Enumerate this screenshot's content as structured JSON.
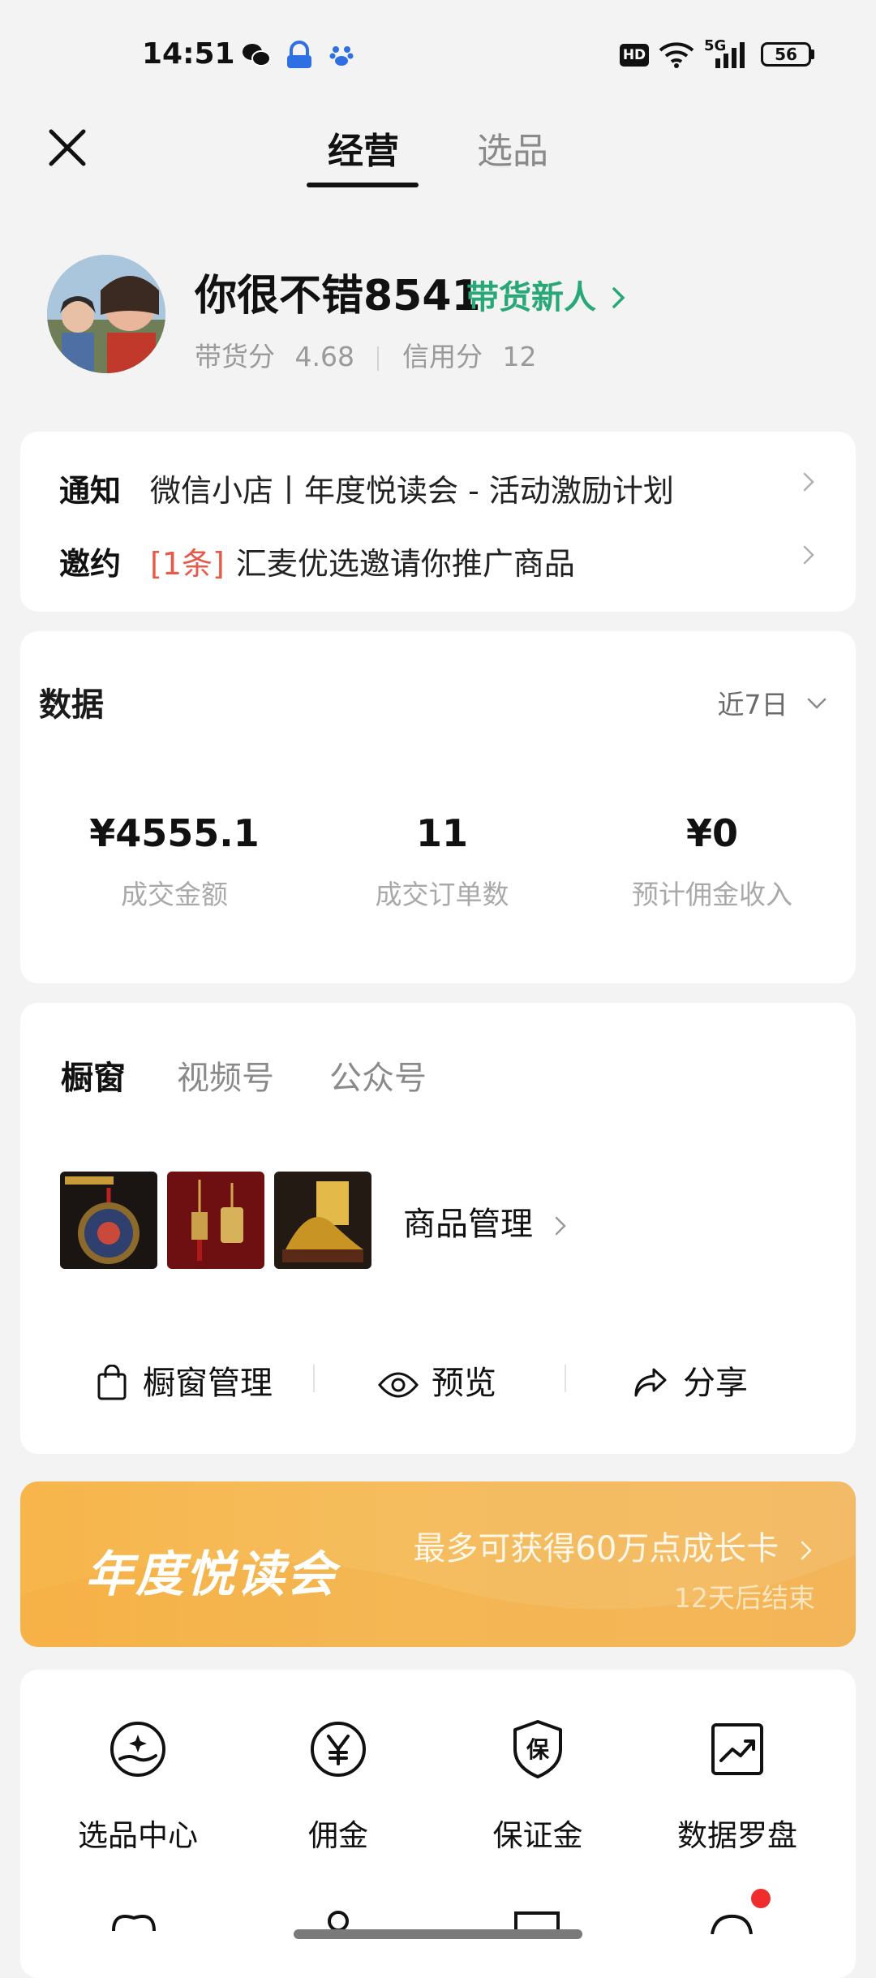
{
  "status_bar": {
    "time": "14:51",
    "network_label": "5G",
    "battery": "56",
    "hd_label": "HD"
  },
  "nav": {
    "tabs": [
      "经营",
      "选品"
    ],
    "active_tab": "经营"
  },
  "profile": {
    "name": "你很不错8541",
    "level": "带货新人",
    "sales_score_label": "带货分",
    "sales_score": "4.68",
    "credit_label": "信用分",
    "credit_score": "12"
  },
  "notices": {
    "notice": {
      "key": "通知",
      "text": "微信小店丨年度悦读会 - 活动激励计划"
    },
    "invite": {
      "key": "邀约",
      "count": "[1条]",
      "text": "汇麦优选邀请你推广商品"
    }
  },
  "data_section": {
    "title": "数据",
    "range": "近7日",
    "metrics": [
      {
        "value": "¥4555.1",
        "label": "成交金额"
      },
      {
        "value": "11",
        "label": "成交订单数"
      },
      {
        "value": "¥0",
        "label": "预计佣金收入"
      }
    ]
  },
  "showcase": {
    "tabs": [
      "橱窗",
      "视频号",
      "公众号"
    ],
    "active_tab": "橱窗",
    "goods_manage": "商品管理",
    "actions": [
      "橱窗管理",
      "预览",
      "分享"
    ]
  },
  "banner": {
    "title": "年度悦读会",
    "reward": "最多可获得60万点成长卡",
    "ends": "12天后结束"
  },
  "tools": [
    {
      "label": "选品中心",
      "icon": "star-hand-icon"
    },
    {
      "label": "佣金",
      "icon": "yen-circle-icon"
    },
    {
      "label": "保证金",
      "icon": "shield-bao-icon"
    },
    {
      "label": "数据罗盘",
      "icon": "chart-up-icon"
    }
  ],
  "colors": {
    "accent_green": "#27a876",
    "alert_red": "#e55a4a",
    "banner_orange": "#f5b752"
  }
}
